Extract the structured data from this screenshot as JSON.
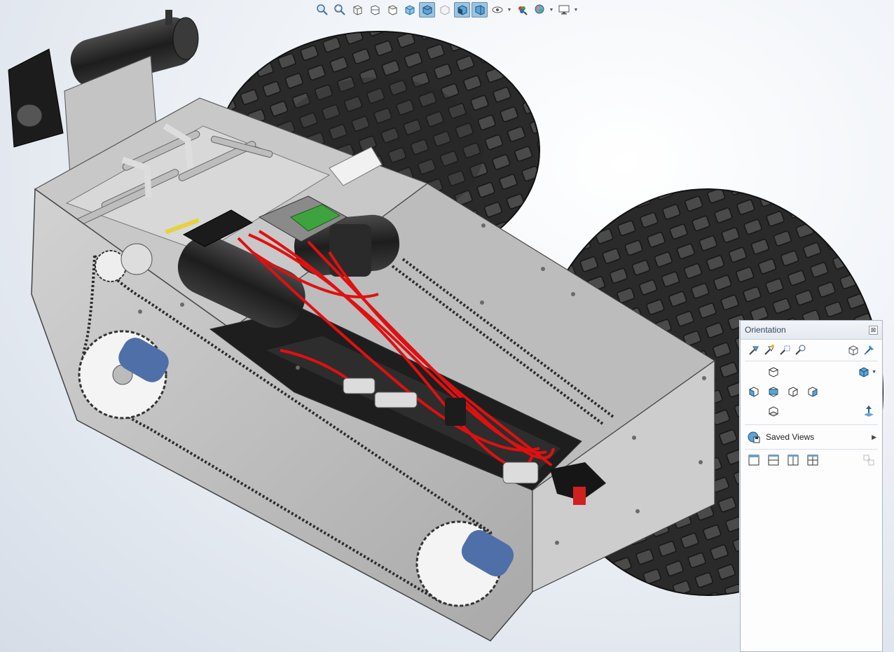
{
  "toolbar": {
    "buttons": [
      {
        "icon": "zoom-to-fit-icon"
      },
      {
        "icon": "zoom-to-area-icon"
      },
      {
        "icon": "previous-view-icon"
      },
      {
        "icon": "section-view-icon"
      },
      {
        "icon": "dynamic-annotation-icon"
      },
      {
        "icon": "view-orientation-icon"
      },
      {
        "icon": "display-style-icon",
        "active": true
      },
      {
        "icon": "hide-show-items-icon"
      },
      {
        "icon": "shadows-icon",
        "active": true
      },
      {
        "icon": "perspective-icon",
        "active": true
      },
      {
        "icon": "visibility-icon"
      },
      {
        "icon": "edit-appearance-icon"
      },
      {
        "icon": "apply-scene-icon"
      },
      {
        "icon": "view-settings-icon"
      }
    ]
  },
  "orientation": {
    "title": "Orientation",
    "close_glyph": "⊠",
    "saved_views_label": "Saved Views",
    "top_icons": [
      "new-view-icon",
      "update-standard-views-icon",
      "reset-standard-views-icon",
      "view-selector-icon"
    ],
    "pin_icon": "pin-icon",
    "views": {
      "top": "top-view-icon",
      "row": [
        "left-view-icon",
        "front-view-icon",
        "right-view-icon",
        "back-view-icon"
      ],
      "bottom": "bottom-view-icon",
      "iso": "isometric-view-icon",
      "normal_to": "normal-to-icon"
    },
    "viewports": [
      "single-view-icon",
      "two-view-horizontal-icon",
      "two-view-vertical-icon",
      "four-view-icon"
    ],
    "link_views": "link-views-icon"
  },
  "colors": {
    "accent": "#9fc3de",
    "wire": "#e01010",
    "chassis": "#b9b9b9",
    "tire": "#2c2c2c"
  }
}
